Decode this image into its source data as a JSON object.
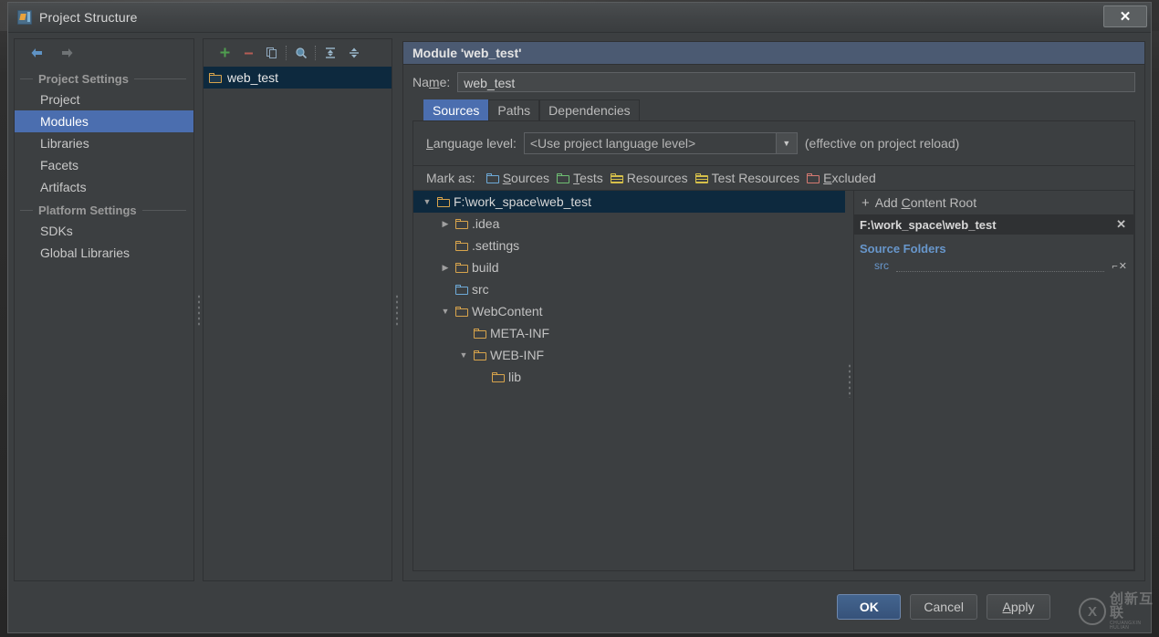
{
  "window": {
    "title": "Project Structure",
    "app_icon": "intellij-idea-icon",
    "close_label": "✕"
  },
  "nav_toolbar": {
    "back_icon": "arrow-back-icon",
    "forward_icon": "arrow-forward-icon"
  },
  "sidebar": {
    "groups": [
      {
        "header": "Project Settings",
        "items": [
          {
            "label": "Project",
            "selected": false
          },
          {
            "label": "Modules",
            "selected": true
          },
          {
            "label": "Libraries",
            "selected": false
          },
          {
            "label": "Facets",
            "selected": false
          },
          {
            "label": "Artifacts",
            "selected": false
          }
        ]
      },
      {
        "header": "Platform Settings",
        "items": [
          {
            "label": "SDKs",
            "selected": false
          },
          {
            "label": "Global Libraries",
            "selected": false
          }
        ]
      }
    ]
  },
  "modules_toolbar": {
    "add": "+",
    "remove": "−",
    "copy_icon": "copy-icon",
    "search_icon": "search-icon",
    "expand_all_icon": "expand-all-icon",
    "collapse_all_icon": "collapse-all-icon"
  },
  "modules_list": {
    "items": [
      {
        "label": "web_test",
        "selected": true,
        "icon": "module-folder-icon"
      }
    ]
  },
  "module_panel": {
    "header": "Module 'web_test'",
    "name_label": "Name:",
    "name_value": "web_test",
    "tabs": [
      {
        "label": "Sources",
        "active": true
      },
      {
        "label": "Paths",
        "active": false
      },
      {
        "label": "Dependencies",
        "active": false
      }
    ],
    "language_level": {
      "label": "Language level:",
      "value": "<Use project language level>",
      "arrow": "▼",
      "note": "(effective on project reload)"
    },
    "mark_as": {
      "label": "Mark as:",
      "options": [
        {
          "label": "Sources",
          "mnemonic": "S",
          "color": "#6eaad8",
          "icon": "folder-sources-icon"
        },
        {
          "label": "Tests",
          "mnemonic": "T",
          "color": "#6fbf73",
          "icon": "folder-tests-icon"
        },
        {
          "label": "Resources",
          "mnemonic": "R",
          "color": "#d6c04a",
          "icon": "folder-resources-icon"
        },
        {
          "label": "Test Resources",
          "mnemonic": "",
          "color": "#d6c04a",
          "icon": "folder-test-resources-icon"
        },
        {
          "label": "Excluded",
          "mnemonic": "E",
          "color": "#d67a72",
          "icon": "folder-excluded-icon"
        }
      ]
    },
    "tree": [
      {
        "label": "F:\\work_space\\web_test",
        "depth": 0,
        "twisty": "▼",
        "icon_color": "#d8a44c",
        "selected": true
      },
      {
        "label": ".idea",
        "depth": 1,
        "twisty": "▶",
        "icon_color": "#d8a44c",
        "selected": false
      },
      {
        "label": ".settings",
        "depth": 1,
        "twisty": "",
        "icon_color": "#d8a44c",
        "selected": false
      },
      {
        "label": "build",
        "depth": 1,
        "twisty": "▶",
        "icon_color": "#d8a44c",
        "selected": false
      },
      {
        "label": "src",
        "depth": 1,
        "twisty": "",
        "icon_color": "#6eaad8",
        "selected": false
      },
      {
        "label": "WebContent",
        "depth": 1,
        "twisty": "▼",
        "icon_color": "#d8a44c",
        "selected": false
      },
      {
        "label": "META-INF",
        "depth": 2,
        "twisty": "",
        "icon_color": "#d8a44c",
        "selected": false
      },
      {
        "label": "WEB-INF",
        "depth": 2,
        "twisty": "▼",
        "icon_color": "#d8a44c",
        "selected": false
      },
      {
        "label": "lib",
        "depth": 3,
        "twisty": "",
        "icon_color": "#d8a44c",
        "selected": false
      }
    ],
    "content_roots": {
      "add_label": "Add Content Root",
      "add_mnemonic": "C",
      "add_plus": "+",
      "root_path": "F:\\work_space\\web_test",
      "root_remove": "✕",
      "source_folders_title": "Source Folders",
      "entries": [
        {
          "name": "src",
          "actions": "⌐✕"
        }
      ]
    }
  },
  "footer": {
    "ok": "OK",
    "cancel": "Cancel",
    "apply": "Apply",
    "apply_mnemonic": "A"
  },
  "watermark": {
    "logo": "X",
    "cn": "创新互联",
    "en": "CHUANGXIN HULIAN"
  },
  "colors": {
    "accent_blue": "#4b6eaf",
    "selection_dark": "#0d293e",
    "panel_bg": "#3c3f41",
    "header_blue": "#4b5a72",
    "link_blue": "#6897cc"
  }
}
